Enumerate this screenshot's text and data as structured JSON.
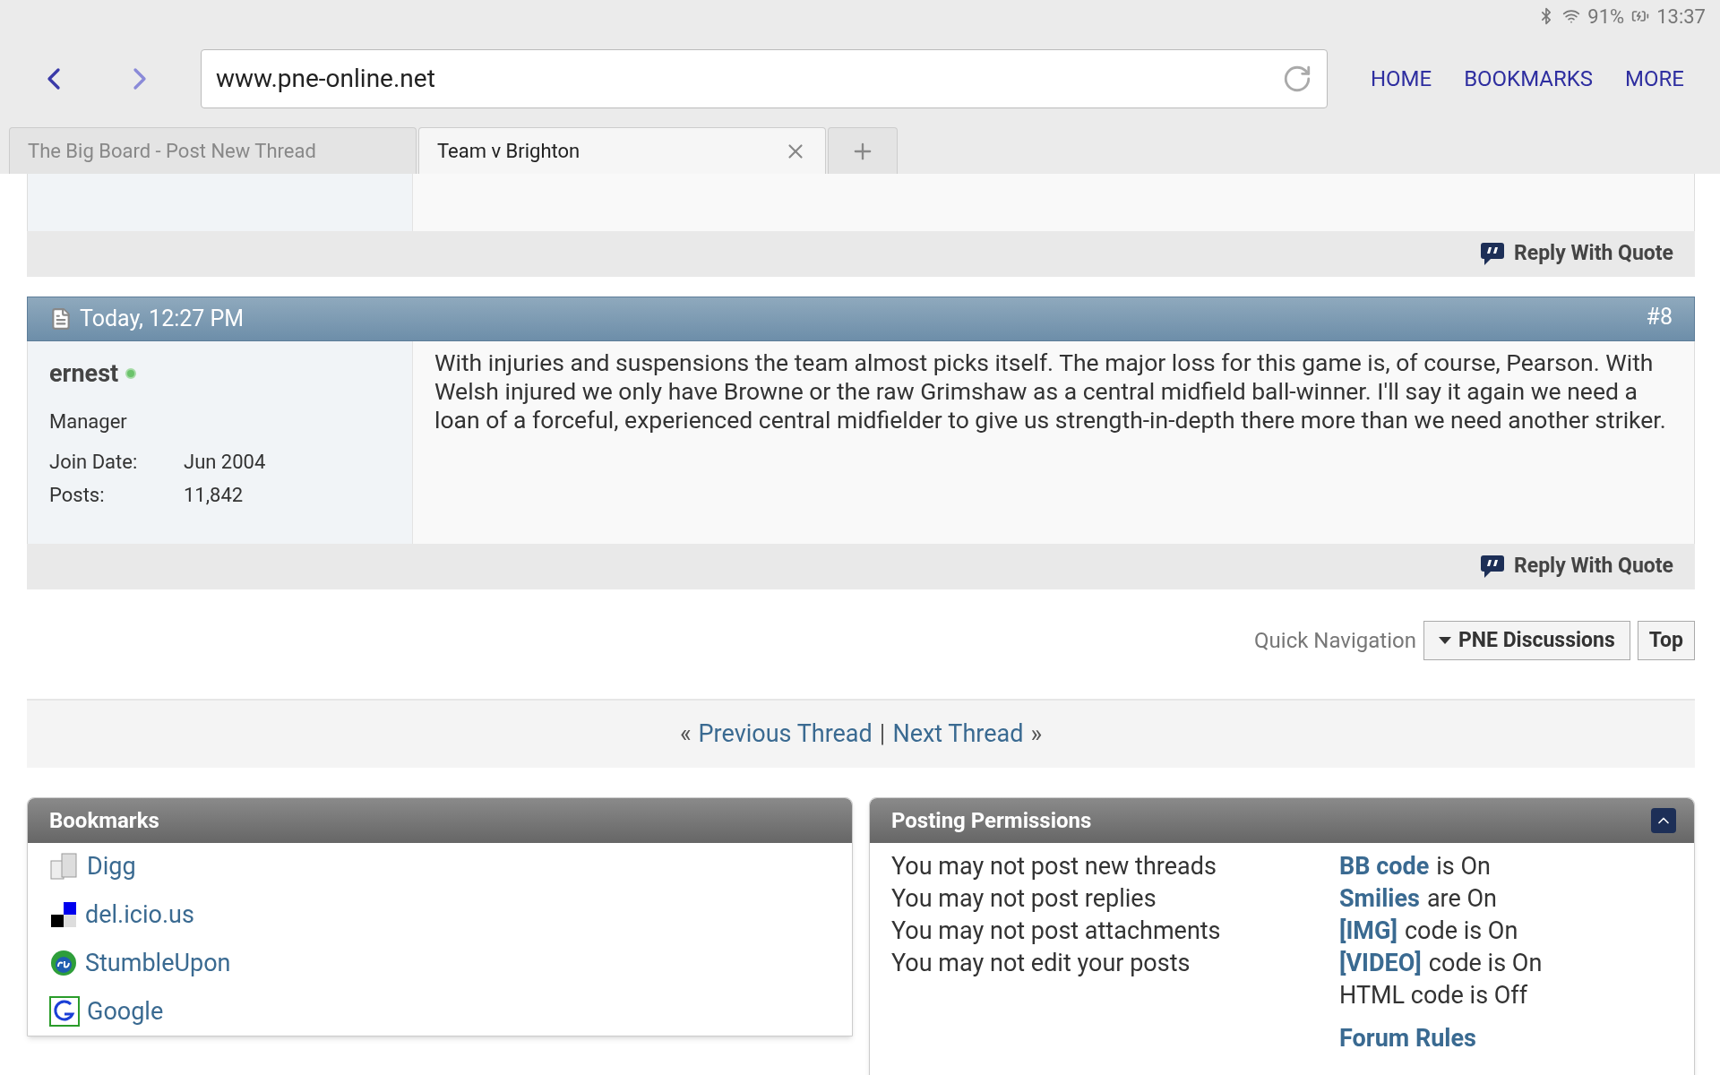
{
  "status_bar": {
    "battery": "91%",
    "time": "13:37"
  },
  "browser": {
    "url": "www.pne-online.net",
    "menu": [
      "HOME",
      "BOOKMARKS",
      "MORE"
    ],
    "tabs": [
      {
        "label": "The Big Board - Post New Thread",
        "selected": false
      },
      {
        "label": "Team v Brighton",
        "selected": true
      }
    ]
  },
  "previous_post": {
    "action": "Reply With Quote"
  },
  "post": {
    "date": "Today, 12:27 PM",
    "number": "#8",
    "author": "ernest",
    "online": true,
    "rank": "Manager",
    "details": [
      {
        "label": "Join Date:",
        "value": "Jun 2004"
      },
      {
        "label": "Posts:",
        "value": "11,842"
      }
    ],
    "body": "With injuries and suspensions the team almost picks itself. The major loss for this game is, of course, Pearson. With Welsh injured we only have Browne or the raw Grimshaw as a central midfield ball-winner. I'll say it again we need a loan of a forceful, experienced central midfielder to give us strength-in-depth there more than we need another striker.",
    "action": "Reply With Quote"
  },
  "quick_navigation": {
    "label": "Quick Navigation",
    "select": "PNE Discussions",
    "top": "Top"
  },
  "thread_nav": {
    "previous": "Previous Thread",
    "next": "Next Thread",
    "separator": "|",
    "prev_mark": "«",
    "next_mark": "»"
  },
  "bookmarks": {
    "title": "Bookmarks",
    "items": [
      {
        "label": "Digg",
        "kind": "digg"
      },
      {
        "label": "del.icio.us",
        "kind": "delicious"
      },
      {
        "label": "StumbleUpon",
        "kind": "stumble"
      },
      {
        "label": "Google",
        "kind": "google"
      }
    ]
  },
  "permissions": {
    "title": "Posting Permissions",
    "expanded": true,
    "rules": [
      "You may not post new threads",
      "You may not post replies",
      "You may not post attachments",
      "You may not edit your posts"
    ],
    "settings": [
      {
        "link": "BB code",
        "text": "is On"
      },
      {
        "link": "Smilies",
        "text": "are On"
      },
      {
        "link": "[IMG]",
        "text": "code is On"
      },
      {
        "link": "[VIDEO]",
        "text": "code is On"
      },
      {
        "text": "HTML code is Off"
      }
    ],
    "forum_rules": "Forum Rules"
  }
}
